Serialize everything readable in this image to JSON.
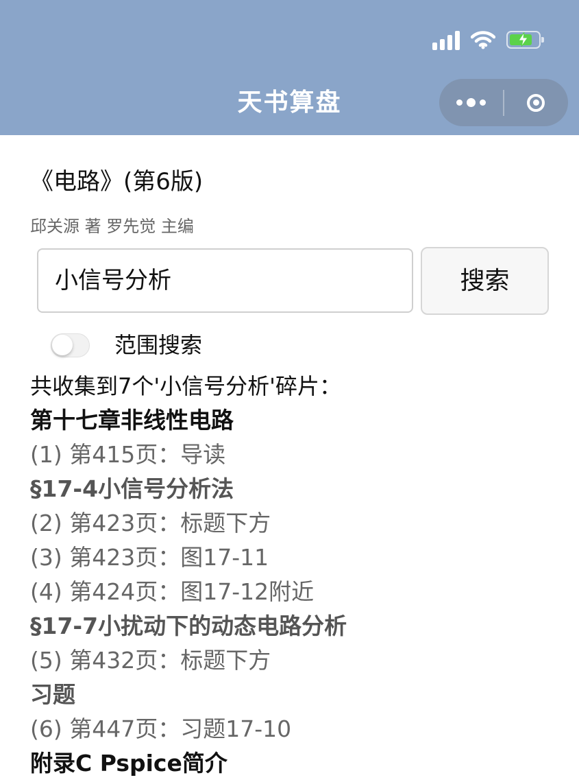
{
  "app": {
    "title": "天书算盘"
  },
  "book": {
    "title": "《电路》(第6版)",
    "authors": "邱关源 著 罗先觉 主编"
  },
  "search": {
    "value": "小信号分析",
    "button_label": "搜索"
  },
  "range_search": {
    "label": "范围搜索",
    "enabled": false
  },
  "summary": "共收集到7个'小信号分析'碎片：",
  "results": [
    {
      "type": "chapter",
      "text": "第十七章非线性电路"
    },
    {
      "type": "item",
      "text": "(1) 第415页：导读"
    },
    {
      "type": "section",
      "text": "§17-4小信号分析法"
    },
    {
      "type": "item",
      "text": "(2) 第423页：标题下方"
    },
    {
      "type": "item",
      "text": "(3) 第423页：图17-11"
    },
    {
      "type": "item",
      "text": "(4) 第424页：图17-12附近"
    },
    {
      "type": "section",
      "text": "§17-7小扰动下的动态电路分析"
    },
    {
      "type": "item",
      "text": "(5) 第432页：标题下方"
    },
    {
      "type": "section",
      "text": "习题"
    },
    {
      "type": "item",
      "text": "(6) 第447页：习题17-10"
    },
    {
      "type": "chapter",
      "text": "附录C Pspice简介"
    }
  ],
  "icons": {
    "status": [
      "signal-icon",
      "wifi-icon",
      "battery-charging-icon"
    ],
    "capsule": [
      "more-icon",
      "close-miniprogram-icon"
    ]
  },
  "colors": {
    "header": "#8aa5c9",
    "battery": "#5cd24a"
  }
}
